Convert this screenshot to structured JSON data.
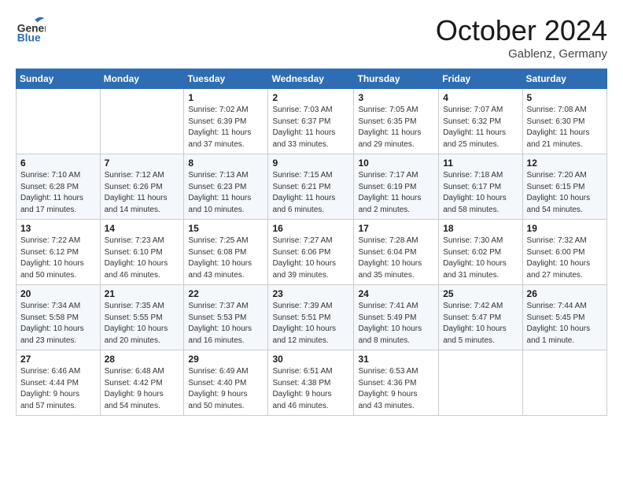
{
  "logo": {
    "general": "General",
    "blue": "Blue"
  },
  "header": {
    "month": "October 2024",
    "location": "Gablenz, Germany"
  },
  "days_of_week": [
    "Sunday",
    "Monday",
    "Tuesday",
    "Wednesday",
    "Thursday",
    "Friday",
    "Saturday"
  ],
  "weeks": [
    [
      {
        "day": "",
        "content": ""
      },
      {
        "day": "",
        "content": ""
      },
      {
        "day": "1",
        "content": "Sunrise: 7:02 AM\nSunset: 6:39 PM\nDaylight: 11 hours\nand 37 minutes."
      },
      {
        "day": "2",
        "content": "Sunrise: 7:03 AM\nSunset: 6:37 PM\nDaylight: 11 hours\nand 33 minutes."
      },
      {
        "day": "3",
        "content": "Sunrise: 7:05 AM\nSunset: 6:35 PM\nDaylight: 11 hours\nand 29 minutes."
      },
      {
        "day": "4",
        "content": "Sunrise: 7:07 AM\nSunset: 6:32 PM\nDaylight: 11 hours\nand 25 minutes."
      },
      {
        "day": "5",
        "content": "Sunrise: 7:08 AM\nSunset: 6:30 PM\nDaylight: 11 hours\nand 21 minutes."
      }
    ],
    [
      {
        "day": "6",
        "content": "Sunrise: 7:10 AM\nSunset: 6:28 PM\nDaylight: 11 hours\nand 17 minutes."
      },
      {
        "day": "7",
        "content": "Sunrise: 7:12 AM\nSunset: 6:26 PM\nDaylight: 11 hours\nand 14 minutes."
      },
      {
        "day": "8",
        "content": "Sunrise: 7:13 AM\nSunset: 6:23 PM\nDaylight: 11 hours\nand 10 minutes."
      },
      {
        "day": "9",
        "content": "Sunrise: 7:15 AM\nSunset: 6:21 PM\nDaylight: 11 hours\nand 6 minutes."
      },
      {
        "day": "10",
        "content": "Sunrise: 7:17 AM\nSunset: 6:19 PM\nDaylight: 11 hours\nand 2 minutes."
      },
      {
        "day": "11",
        "content": "Sunrise: 7:18 AM\nSunset: 6:17 PM\nDaylight: 10 hours\nand 58 minutes."
      },
      {
        "day": "12",
        "content": "Sunrise: 7:20 AM\nSunset: 6:15 PM\nDaylight: 10 hours\nand 54 minutes."
      }
    ],
    [
      {
        "day": "13",
        "content": "Sunrise: 7:22 AM\nSunset: 6:12 PM\nDaylight: 10 hours\nand 50 minutes."
      },
      {
        "day": "14",
        "content": "Sunrise: 7:23 AM\nSunset: 6:10 PM\nDaylight: 10 hours\nand 46 minutes."
      },
      {
        "day": "15",
        "content": "Sunrise: 7:25 AM\nSunset: 6:08 PM\nDaylight: 10 hours\nand 43 minutes."
      },
      {
        "day": "16",
        "content": "Sunrise: 7:27 AM\nSunset: 6:06 PM\nDaylight: 10 hours\nand 39 minutes."
      },
      {
        "day": "17",
        "content": "Sunrise: 7:28 AM\nSunset: 6:04 PM\nDaylight: 10 hours\nand 35 minutes."
      },
      {
        "day": "18",
        "content": "Sunrise: 7:30 AM\nSunset: 6:02 PM\nDaylight: 10 hours\nand 31 minutes."
      },
      {
        "day": "19",
        "content": "Sunrise: 7:32 AM\nSunset: 6:00 PM\nDaylight: 10 hours\nand 27 minutes."
      }
    ],
    [
      {
        "day": "20",
        "content": "Sunrise: 7:34 AM\nSunset: 5:58 PM\nDaylight: 10 hours\nand 23 minutes."
      },
      {
        "day": "21",
        "content": "Sunrise: 7:35 AM\nSunset: 5:55 PM\nDaylight: 10 hours\nand 20 minutes."
      },
      {
        "day": "22",
        "content": "Sunrise: 7:37 AM\nSunset: 5:53 PM\nDaylight: 10 hours\nand 16 minutes."
      },
      {
        "day": "23",
        "content": "Sunrise: 7:39 AM\nSunset: 5:51 PM\nDaylight: 10 hours\nand 12 minutes."
      },
      {
        "day": "24",
        "content": "Sunrise: 7:41 AM\nSunset: 5:49 PM\nDaylight: 10 hours\nand 8 minutes."
      },
      {
        "day": "25",
        "content": "Sunrise: 7:42 AM\nSunset: 5:47 PM\nDaylight: 10 hours\nand 5 minutes."
      },
      {
        "day": "26",
        "content": "Sunrise: 7:44 AM\nSunset: 5:45 PM\nDaylight: 10 hours\nand 1 minute."
      }
    ],
    [
      {
        "day": "27",
        "content": "Sunrise: 6:46 AM\nSunset: 4:44 PM\nDaylight: 9 hours\nand 57 minutes."
      },
      {
        "day": "28",
        "content": "Sunrise: 6:48 AM\nSunset: 4:42 PM\nDaylight: 9 hours\nand 54 minutes."
      },
      {
        "day": "29",
        "content": "Sunrise: 6:49 AM\nSunset: 4:40 PM\nDaylight: 9 hours\nand 50 minutes."
      },
      {
        "day": "30",
        "content": "Sunrise: 6:51 AM\nSunset: 4:38 PM\nDaylight: 9 hours\nand 46 minutes."
      },
      {
        "day": "31",
        "content": "Sunrise: 6:53 AM\nSunset: 4:36 PM\nDaylight: 9 hours\nand 43 minutes."
      },
      {
        "day": "",
        "content": ""
      },
      {
        "day": "",
        "content": ""
      }
    ]
  ]
}
